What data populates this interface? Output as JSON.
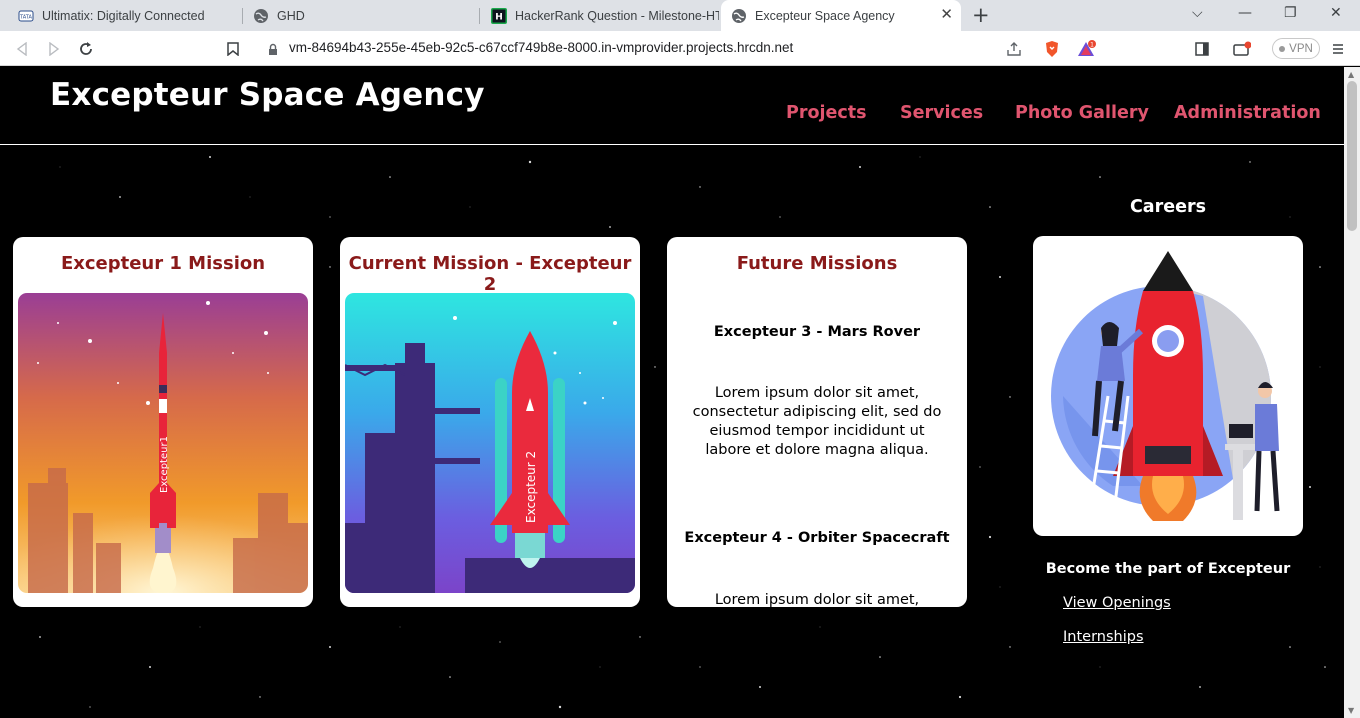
{
  "browser": {
    "tabs": [
      {
        "title": "Ultimatix: Digitally Connected",
        "icon": "tata-icon"
      },
      {
        "title": "GHD",
        "icon": "globe-icon"
      },
      {
        "title": "HackerRank Question - Milestone-HTML",
        "icon": "hackerrank-icon"
      },
      {
        "title": "Excepteur Space Agency",
        "icon": "globe-icon",
        "active": true
      }
    ],
    "url": "vm-84694b43-255e-45eb-92c5-c67ccf749b8e-8000.in-vmprovider.projects.hrcdn.net",
    "vpn_label": "VPN",
    "brave_badge": "1"
  },
  "site": {
    "title": "Excepteur Space Agency",
    "nav": [
      "Projects",
      "Services",
      "Photo Gallery",
      "Administration"
    ],
    "nav_color": "#e0556f"
  },
  "missions": [
    {
      "title": "Excepteur 1 Mission",
      "rocket_label": "Excepteur1"
    },
    {
      "title": "Current Mission - Excepteur 2",
      "rocket_label": "Excepteur 2"
    },
    {
      "title": "Future Missions",
      "items": [
        {
          "name": "Excepteur 3 - Mars Rover",
          "text": "Lorem ipsum dolor sit amet, consectetur adipiscing elit, sed do eiusmod tempor incididunt ut labore et dolore magna aliqua."
        },
        {
          "name": "Excepteur 4 - Orbiter Spacecraft",
          "text": "Lorem ipsum dolor sit amet,"
        }
      ]
    }
  ],
  "careers": {
    "title": "Careers",
    "subtitle": "Become the part of Excepteur",
    "links": [
      "View Openings",
      "Internships"
    ]
  },
  "colors": {
    "card_title": "#8a1a1a",
    "background": "#000000"
  }
}
